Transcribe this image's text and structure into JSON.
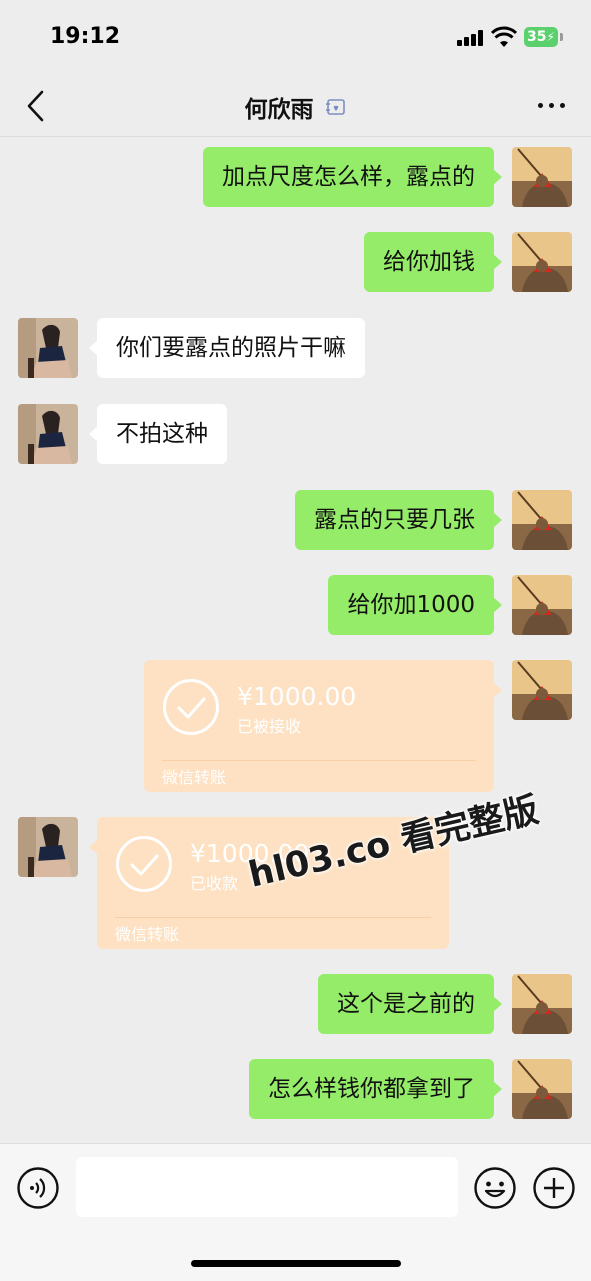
{
  "status_bar": {
    "time": "19:12",
    "battery": "35"
  },
  "header": {
    "title": "何欣雨",
    "back_icon": "chevron-left-icon",
    "more_icon": "ellipsis-icon",
    "badge_icon": "contact-card-icon"
  },
  "messages": [
    {
      "sender": "me",
      "type": "text",
      "text": "加点尺度怎么样，露点的"
    },
    {
      "sender": "me",
      "type": "text",
      "text": "给你加钱"
    },
    {
      "sender": "them",
      "type": "text",
      "text": "你们要露点的照片干嘛"
    },
    {
      "sender": "them",
      "type": "text",
      "text": "不拍这种"
    },
    {
      "sender": "me",
      "type": "text",
      "text": "露点的只要几张"
    },
    {
      "sender": "me",
      "type": "text",
      "text": "给你加1000"
    },
    {
      "sender": "me",
      "type": "transfer",
      "amount": "¥1000.00",
      "status": "已被接收",
      "brand": "微信转账"
    },
    {
      "sender": "them",
      "type": "transfer",
      "amount": "¥1000.00",
      "status": "已收款",
      "brand": "微信转账"
    },
    {
      "sender": "me",
      "type": "text",
      "text": "这个是之前的"
    },
    {
      "sender": "me",
      "type": "text",
      "text": "怎么样钱你都拿到了"
    }
  ],
  "watermark": "hl03.co 看完整版",
  "input_bar": {
    "placeholder": "",
    "voice_icon": "voice-icon",
    "emoji_icon": "emoji-icon",
    "plus_icon": "plus-icon"
  },
  "colors": {
    "my_bubble": "#95ec69",
    "their_bubble": "#ffffff",
    "transfer_card": "#fde1c2",
    "background": "#ededed"
  }
}
